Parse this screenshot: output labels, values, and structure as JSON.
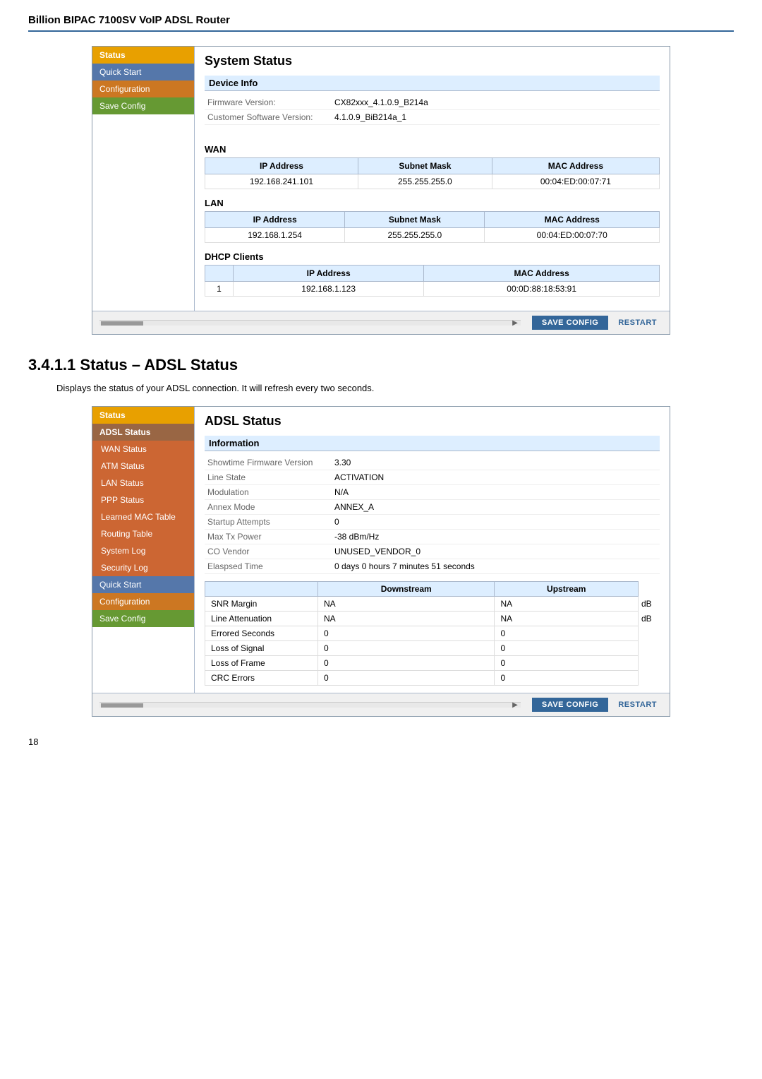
{
  "header": {
    "title": "Billion BIPAC 7100SV VoIP ADSL Router"
  },
  "panel1": {
    "title": "System Status",
    "sidebar": {
      "items": [
        {
          "label": "Status",
          "style": "active-status"
        },
        {
          "label": "Quick Start",
          "style": "menu-blue"
        },
        {
          "label": "Configuration",
          "style": "menu-orange"
        },
        {
          "label": "Save Config",
          "style": "menu-green"
        }
      ]
    },
    "deviceInfo": {
      "sectionLabel": "Device Info",
      "fields": [
        {
          "label": "Firmware Version:",
          "value": "CX82xxx_4.1.0.9_B214a"
        },
        {
          "label": "Customer Software Version:",
          "value": "4.1.0.9_BiB214a_1"
        }
      ]
    },
    "wan": {
      "label": "WAN",
      "columns": [
        "IP Address",
        "Subnet Mask",
        "MAC Address"
      ],
      "rows": [
        [
          "192.168.241.101",
          "255.255.255.0",
          "00:04:ED:00:07:71"
        ]
      ]
    },
    "lan": {
      "label": "LAN",
      "columns": [
        "IP Address",
        "Subnet Mask",
        "MAC Address"
      ],
      "rows": [
        [
          "192.168.1.254",
          "255.255.255.0",
          "00:04:ED:00:07:70"
        ]
      ]
    },
    "dhcp": {
      "label": "DHCP Clients",
      "columns": [
        "IP Address",
        "MAC Address"
      ],
      "rows": [
        [
          "1",
          "192.168.1.123",
          "00:0D:88:18:53:91"
        ]
      ]
    },
    "buttons": {
      "save": "SAVE CONFIG",
      "restart": "RESTART"
    }
  },
  "section341": {
    "title": "3.4.1.1 Status – ADSL Status",
    "desc": "Displays the status of your ADSL connection. It will refresh every two seconds."
  },
  "panel2": {
    "title": "ADSL Status",
    "sidebar": {
      "items": [
        {
          "label": "Status",
          "style": "active-status"
        },
        {
          "label": "ADSL Status",
          "style": "menu-subitem-selected"
        },
        {
          "label": "WAN Status",
          "style": "menu-subitem"
        },
        {
          "label": "ATM Status",
          "style": "menu-subitem"
        },
        {
          "label": "LAN Status",
          "style": "menu-subitem"
        },
        {
          "label": "PPP Status",
          "style": "menu-subitem"
        },
        {
          "label": "Learned MAC Table",
          "style": "menu-subitem"
        },
        {
          "label": "Routing Table",
          "style": "menu-subitem"
        },
        {
          "label": "System Log",
          "style": "menu-subitem"
        },
        {
          "label": "Security Log",
          "style": "menu-subitem"
        },
        {
          "label": "Quick Start",
          "style": "menu-blue"
        },
        {
          "label": "Configuration",
          "style": "menu-orange"
        },
        {
          "label": "Save Config",
          "style": "menu-green"
        }
      ]
    },
    "information": {
      "sectionLabel": "Information",
      "fields": [
        {
          "label": "Showtime Firmware Version",
          "value": "3.30"
        },
        {
          "label": "Line State",
          "value": "ACTIVATION"
        },
        {
          "label": "Modulation",
          "value": "N/A"
        },
        {
          "label": "Annex Mode",
          "value": "ANNEX_A"
        },
        {
          "label": "Startup Attempts",
          "value": "0"
        },
        {
          "label": "Max Tx Power",
          "value": "-38 dBm/Hz"
        },
        {
          "label": "CO Vendor",
          "value": "UNUSED_VENDOR_0"
        },
        {
          "label": "Elaspsed Time",
          "value": "0 days 0 hours 7 minutes 51 seconds"
        }
      ]
    },
    "dsUsTable": {
      "columns": [
        "",
        "Downstream",
        "Upstream",
        ""
      ],
      "rows": [
        {
          "label": "SNR Margin",
          "downstream": "NA",
          "upstream": "NA",
          "unit": "dB"
        },
        {
          "label": "Line Attenuation",
          "downstream": "NA",
          "upstream": "NA",
          "unit": "dB"
        },
        {
          "label": "Errored Seconds",
          "downstream": "0",
          "upstream": "0",
          "unit": ""
        },
        {
          "label": "Loss of Signal",
          "downstream": "0",
          "upstream": "0",
          "unit": ""
        },
        {
          "label": "Loss of Frame",
          "downstream": "0",
          "upstream": "0",
          "unit": ""
        },
        {
          "label": "CRC Errors",
          "downstream": "0",
          "upstream": "0",
          "unit": ""
        }
      ]
    },
    "buttons": {
      "save": "SAVE CONFIG",
      "restart": "RESTART"
    }
  },
  "footer": {
    "pageNumber": "18"
  }
}
